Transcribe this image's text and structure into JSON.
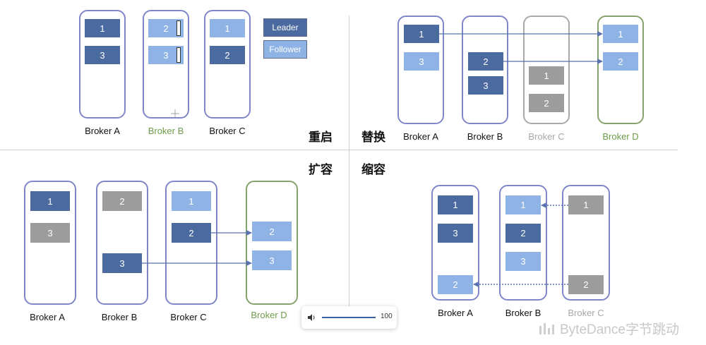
{
  "legend": {
    "leader": "Leader",
    "follower": "Follower"
  },
  "sections": {
    "restart": {
      "title": "重启",
      "brokers": [
        "Broker A",
        "Broker B",
        "Broker C"
      ]
    },
    "replace": {
      "title": "替换",
      "brokers": [
        "Broker A",
        "Broker B",
        "Broker C",
        "Broker D"
      ]
    },
    "expand": {
      "title": "扩容",
      "brokers": [
        "Broker A",
        "Broker B",
        "Broker C",
        "Broker D"
      ]
    },
    "shrink": {
      "title": "缩容",
      "brokers": [
        "Broker A",
        "Broker B",
        "Broker C"
      ]
    }
  },
  "partitions": {
    "p1": "1",
    "p2": "2",
    "p3": "3"
  },
  "volume": {
    "value": "100",
    "icon": "speaker-icon"
  },
  "watermark": {
    "text": "ByteDance字节跳动"
  },
  "colors": {
    "leader": "#4a6aa0",
    "follower": "#8fb3e4",
    "inactive": "#9c9c9c",
    "broker_border": "#7f86c9",
    "new_broker": "#86a36b"
  }
}
